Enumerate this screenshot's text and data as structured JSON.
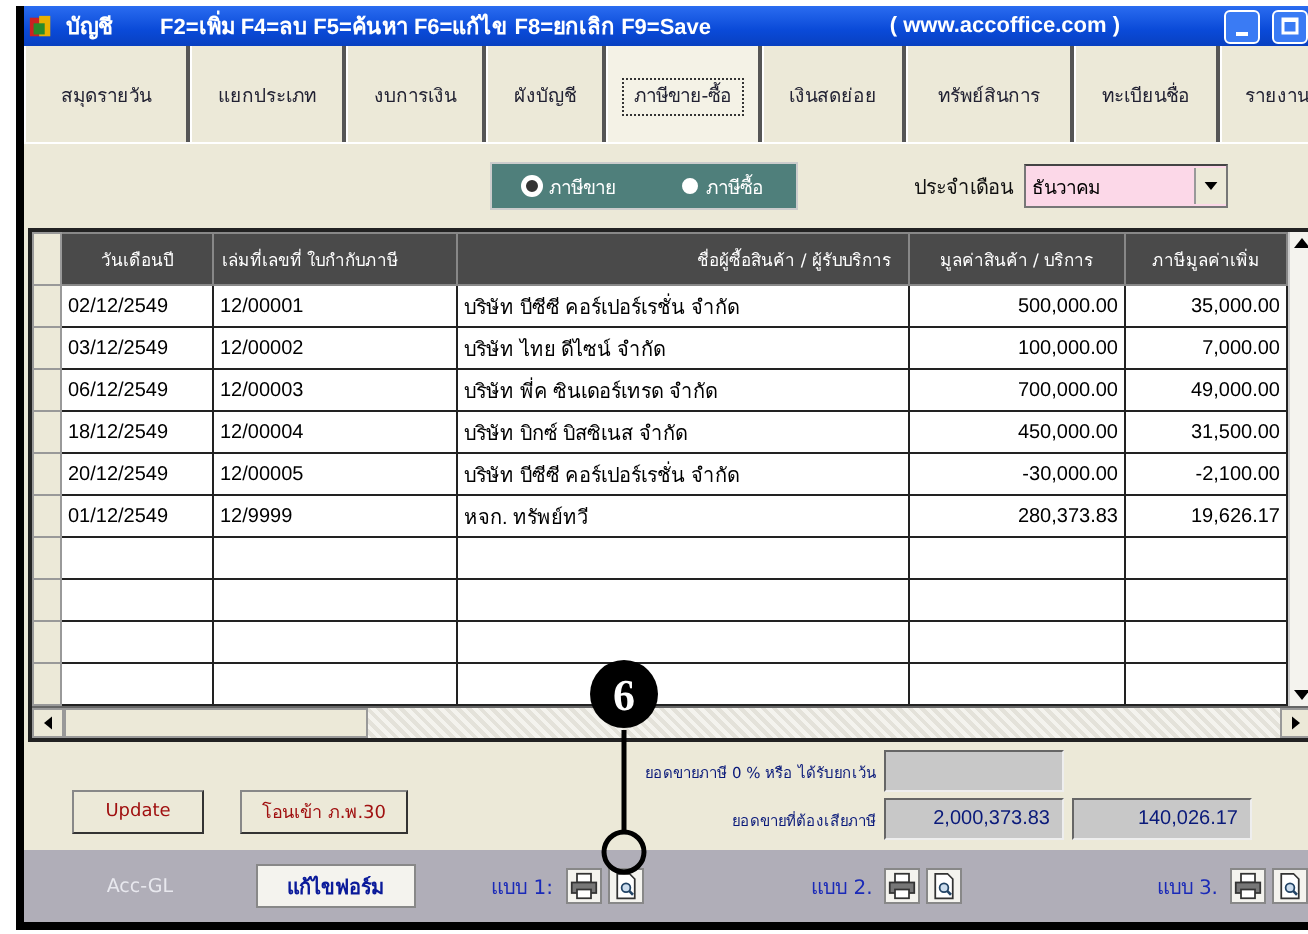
{
  "title_bar": {
    "app_name": "บัญชี",
    "shortcuts": "F2=เพิ่ม F4=ลบ F5=ค้นหา F6=แก้ไข F8=ยกเลิก F9=Save",
    "url": "( www.accoffice.com )"
  },
  "tabs": [
    {
      "label": "สมุดรายวัน",
      "selected": false
    },
    {
      "label": "แยกประเภท",
      "selected": false
    },
    {
      "label": "งบการเงิน",
      "selected": false
    },
    {
      "label": "ผังบัญชี",
      "selected": false
    },
    {
      "label": "ภาษีขาย-ซื้อ",
      "selected": true
    },
    {
      "label": "เงินสดย่อย",
      "selected": false
    },
    {
      "label": "ทรัพย์สินการ",
      "selected": false
    },
    {
      "label": "ทะเบียนชื่อ",
      "selected": false
    },
    {
      "label": "รายงาน",
      "selected": false
    }
  ],
  "tax_type": [
    {
      "label": "ภาษีขาย",
      "selected": true
    },
    {
      "label": "ภาษีซื้อ",
      "selected": false
    }
  ],
  "month": {
    "label": "ประจำเดือน",
    "value": "ธันวาคม"
  },
  "table": {
    "columns": [
      "วันเดือนปี",
      "เล่มที่เลขที่ ใบกำกับภาษี",
      "ชื่อผู้ซื้อสินค้า / ผู้รับบริการ",
      "มูลค่าสินค้า / บริการ",
      "ภาษีมูลค่าเพิ่ม"
    ],
    "rows": [
      [
        "02/12/2549",
        "12/00001",
        "บริษัท  บีซีซี คอร์เปอร์เรชั่น จำกัด",
        "500,000.00",
        "35,000.00"
      ],
      [
        "03/12/2549",
        "12/00002",
        "บริษัท ไทย ดีไซน์ จำกัด",
        "100,000.00",
        "7,000.00"
      ],
      [
        "06/12/2549",
        "12/00003",
        "บริษัท พี่ค ซินเดอร์เทรด จำกัด",
        "700,000.00",
        "49,000.00"
      ],
      [
        "18/12/2549",
        "12/00004",
        "บริษัท บิกซ์ บิสซิเนส จำกัด",
        "450,000.00",
        "31,500.00"
      ],
      [
        "20/12/2549",
        "12/00005",
        "บริษัท บีซีซี คอร์เปอร์เรชั่น จำกัด",
        "-30,000.00",
        "-2,100.00"
      ],
      [
        "01/12/2549",
        "12/9999",
        "หจก. ทรัพย์ทวี",
        "280,373.83",
        "19,626.17"
      ]
    ]
  },
  "totals": {
    "exempt_label": "ยอดขายภาษี 0 % หรือ ได้รับยกเว้น",
    "taxable_label": "ยอดขายที่ต้องเสียภาษี",
    "taxable_amount": "2,000,373.83",
    "taxable_vat": "140,026.17"
  },
  "buttons": [
    "Update",
    "โอนเข้า ภ.พ.30"
  ],
  "footer": {
    "brand": "Acc-GL",
    "edit_button": "แก้ไขฟอร์ม",
    "print_sets": [
      "แบบ 1:",
      "แบบ 2.",
      "แบบ 3."
    ]
  },
  "callout": {
    "label": "6"
  }
}
